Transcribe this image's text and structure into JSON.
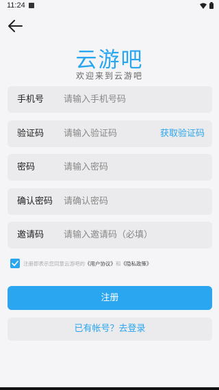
{
  "status_bar": {
    "time": "11:24",
    "notification_icon": "notification-icon",
    "wifi_icon": "wifi-icon",
    "battery_icon": "battery-icon"
  },
  "header": {
    "back_icon": "arrow-left-icon"
  },
  "logo": {
    "title": "云游吧",
    "subtitle": "欢迎来到云游吧",
    "color": "#2aa6f0"
  },
  "form": {
    "phone": {
      "label": "手机号",
      "placeholder": "请输入手机号码",
      "value": ""
    },
    "code": {
      "label": "验证码",
      "placeholder": "请输入验证码",
      "value": "",
      "action_label": "获取验证码"
    },
    "password": {
      "label": "密码",
      "placeholder": "请输入密码",
      "value": ""
    },
    "confirm_password": {
      "label": "确认密码",
      "placeholder": "请确认密码",
      "value": ""
    },
    "invite": {
      "label": "邀请码",
      "placeholder": "请输入邀请码（必填）",
      "value": ""
    }
  },
  "agreement": {
    "checked": true,
    "prefix": "注册即表示您同意云游吧的",
    "user_agreement": "《用户协议》",
    "and": "和",
    "privacy_policy": "《隐私政策》"
  },
  "actions": {
    "register_label": "注册",
    "login_label": "已有帐号？去登录"
  },
  "colors": {
    "accent": "#2aa6f0",
    "field_bg": "#ebebed",
    "page_bg": "#f5f5f7"
  }
}
